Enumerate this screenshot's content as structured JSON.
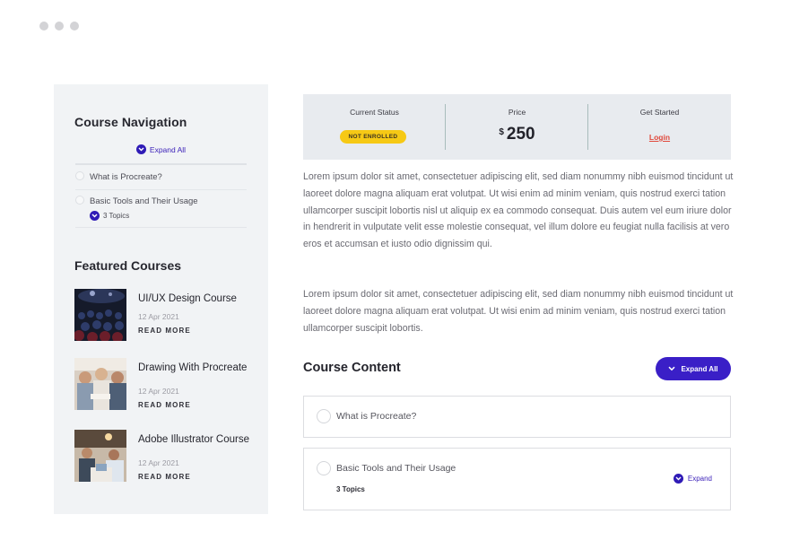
{
  "sidebar": {
    "nav_title": "Course Navigation",
    "expand_all": "Expand All",
    "items": [
      {
        "label": "What is Procreate?"
      },
      {
        "label": "Basic Tools and Their Usage",
        "topics": "3 Topics"
      }
    ],
    "featured_title": "Featured Courses",
    "courses": [
      {
        "name": "UI/UX Design Course",
        "date": "12 Apr 2021",
        "more": "READ MORE"
      },
      {
        "name": "Drawing With Procreate",
        "date": "12 Apr 2021",
        "more": "READ MORE"
      },
      {
        "name": "Adobe Illustrator Course",
        "date": "12 Apr 2021",
        "more": "READ MORE"
      }
    ]
  },
  "status": {
    "current_label": "Current Status",
    "current_value": "NOT ENROLLED",
    "price_label": "Price",
    "price_currency": "$",
    "price_value": "250",
    "start_label": "Get Started",
    "start_link": "Login"
  },
  "content": {
    "para1": "Lorem ipsum dolor sit amet, consectetuer adipiscing elit, sed diam nonummy nibh euismod tincidunt ut laoreet dolore magna aliquam erat volutpat. Ut wisi enim ad minim veniam, quis nostrud exerci tation ullamcorper suscipit lobortis nisl ut aliquip ex ea commodo consequat. Duis autem vel eum iriure dolor in hendrerit in vulputate velit esse molestie consequat, vel illum dolore eu feugiat nulla facilisis at vero eros et accumsan et iusto odio dignissim qui.",
    "para2": "Lorem ipsum dolor sit amet, consectetuer adipiscing elit, sed diam nonummy nibh euismod tincidunt ut laoreet dolore magna aliquam erat volutpat. Ut wisi enim ad minim veniam, quis nostrud exerci tation ullamcorper suscipit lobortis.",
    "course_content_title": "Course Content",
    "expand_all_button": "Expand All",
    "lessons": [
      {
        "label": "What is Procreate?"
      },
      {
        "label": "Basic Tools and Their Usage",
        "topics": "3 Topics",
        "expand": "Expand"
      }
    ]
  },
  "colors": {
    "accent": "#3a1fc7",
    "badge": "#f6c915",
    "login": "#e0483b",
    "sidebar_bg": "#f1f3f5"
  }
}
